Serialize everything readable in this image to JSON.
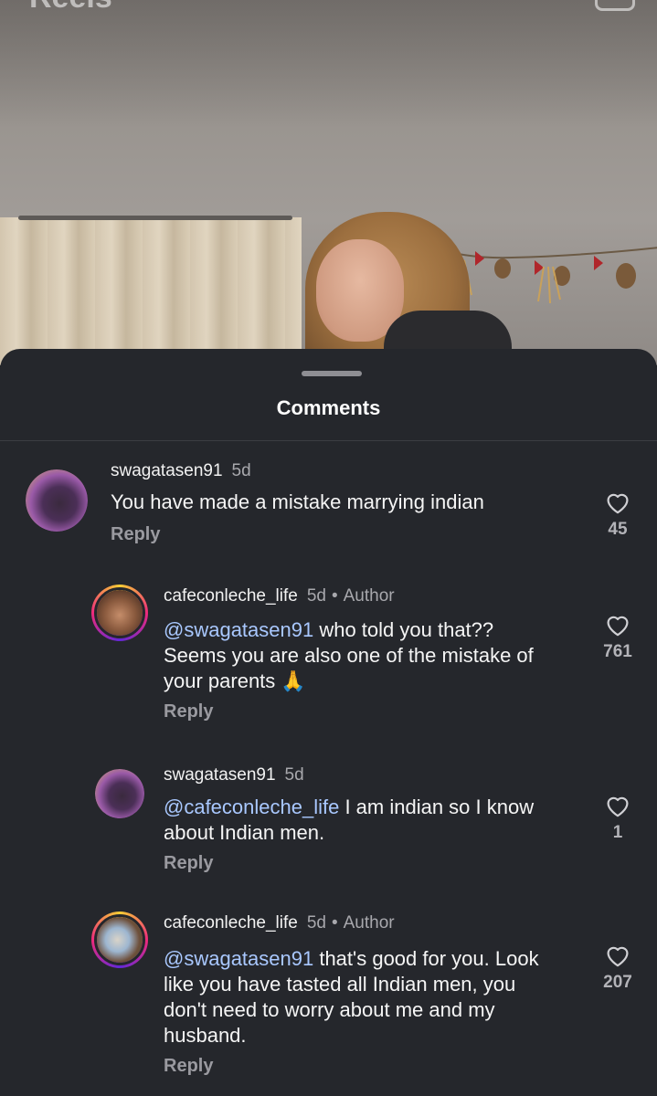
{
  "background": {
    "reels_title": "Reels"
  },
  "sheet": {
    "title": "Comments"
  },
  "comments": [
    {
      "username": "swagatasen91",
      "time": "5d",
      "text": "You have made a mistake marrying indian",
      "reply_label": "Reply",
      "like_count": "45"
    },
    {
      "username": "cafeconleche_life",
      "time": "5d",
      "author_badge": "Author",
      "mention": "@swagatasen91",
      "text_line1": " who told you that??",
      "text_line2": "Seems you are also one of the mistake of",
      "text_line3": "your parents 🙏",
      "reply_label": "Reply",
      "like_count": "761"
    },
    {
      "username": "swagatasen91",
      "time": "5d",
      "mention": "@cafeconleche_life",
      "text_line1": " I am indian so I know",
      "text_line2": "about Indian men.",
      "reply_label": "Reply",
      "like_count": "1"
    },
    {
      "username": "cafeconleche_life",
      "time": "5d",
      "author_badge": "Author",
      "mention": "@swagatasen91",
      "text_line1": " that's good for you. Look",
      "text_line2": "like you have tasted all Indian men, you",
      "text_line3": "don't need to worry about me and my",
      "text_line4": "husband.",
      "reply_label": "Reply",
      "like_count": "207"
    }
  ],
  "icons": {
    "like": "heart-outline-icon"
  }
}
